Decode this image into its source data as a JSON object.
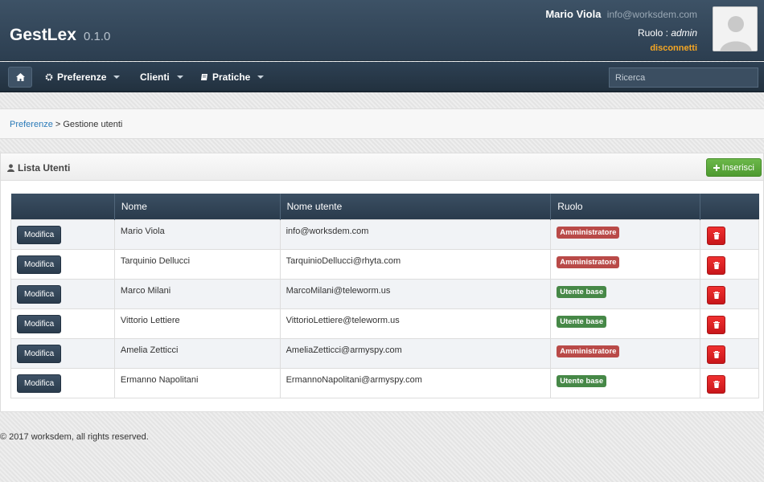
{
  "app": {
    "name": "GestLex",
    "version": "0.1.0"
  },
  "user": {
    "name": "Mario Viola",
    "email": "info@worksdem.com",
    "role_label": "Ruolo :",
    "role": "admin",
    "logout": "disconnetti"
  },
  "nav": {
    "items": [
      {
        "label": "Preferenze",
        "icon": "gear-icon"
      },
      {
        "label": "Clienti",
        "icon": ""
      },
      {
        "label": "Pratiche",
        "icon": "book-icon"
      }
    ],
    "search_placeholder": "Ricerca"
  },
  "breadcrumb": {
    "parent": "Preferenze",
    "separator": ">",
    "current": "Gestione utenti"
  },
  "list": {
    "title": "Lista Utenti",
    "insert_label": "Inserisci",
    "columns": [
      "",
      "Nome",
      "Nome utente",
      "Ruolo",
      ""
    ],
    "edit_label": "Modifica",
    "rows": [
      {
        "name": "Mario Viola",
        "username": "info@worksdem.com",
        "role": "Amministratore"
      },
      {
        "name": "Tarquinio Dellucci",
        "username": "TarquinioDellucci@rhyta.com",
        "role": "Amministratore"
      },
      {
        "name": "Marco Milani",
        "username": "MarcoMilani@teleworm.us",
        "role": "Utente base"
      },
      {
        "name": "Vittorio Lettiere",
        "username": "VittorioLettiere@teleworm.us",
        "role": "Utente base"
      },
      {
        "name": "Amelia Zetticci",
        "username": "AmeliaZetticci@armyspy.com",
        "role": "Amministratore"
      },
      {
        "name": "Ermanno Napolitani",
        "username": "ErmannoNapolitani@armyspy.com",
        "role": "Utente base"
      }
    ]
  },
  "colors": {
    "admin_badge": "#b94a48",
    "base_badge": "#468847",
    "accent": "#f5a623"
  },
  "footer": "© 2017 worksdem, all rights reserved."
}
